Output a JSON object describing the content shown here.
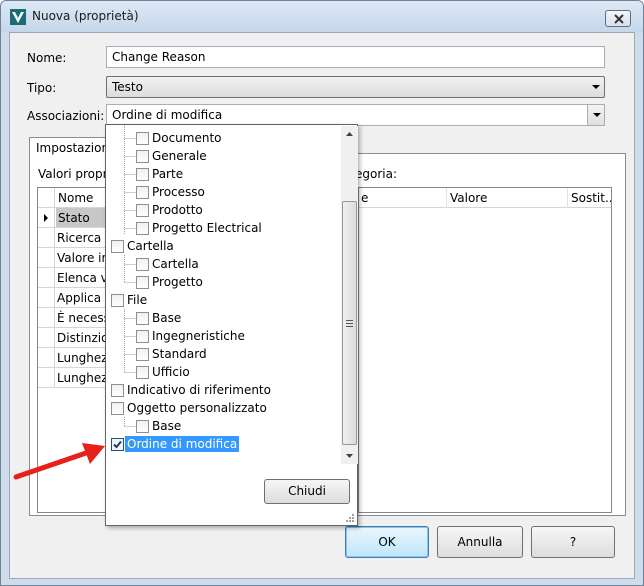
{
  "window": {
    "title": "Nuova (proprietà)"
  },
  "form": {
    "name_label": "Nome:",
    "name_value": "Change  Reason",
    "type_label": "Tipo:",
    "type_value": "Testo",
    "assoc_label": "Associazioni:",
    "assoc_value": "Ordine di modifica"
  },
  "tab": {
    "label": "Impostazioni"
  },
  "left_panel": {
    "label": "Valori propri",
    "header": "Nome",
    "rows": [
      "Stato",
      "Ricerca d",
      "Valore ini",
      "Elenca va",
      "Applica e",
      "È necessa",
      "Distinzio",
      "Lunghezz",
      "Lunghezz"
    ]
  },
  "right_panel": {
    "label": "egoria:",
    "headers": [
      "e",
      "Valore",
      "Sostit..."
    ]
  },
  "buttons": {
    "ok": "OK",
    "cancel": "Annulla",
    "help": "?"
  },
  "dropdown": {
    "close_label": "Chiudi",
    "items": [
      {
        "label": "Documento",
        "checked": false
      },
      {
        "label": "Generale",
        "checked": false
      },
      {
        "label": "Parte",
        "checked": false
      },
      {
        "label": "Processo",
        "checked": false
      },
      {
        "label": "Prodotto",
        "checked": false
      },
      {
        "label": "Progetto Electrical",
        "checked": false
      },
      {
        "label": "Cartella",
        "checked": false
      },
      {
        "label": "Cartella",
        "checked": false
      },
      {
        "label": "Progetto",
        "checked": false
      },
      {
        "label": "File",
        "checked": false
      },
      {
        "label": "Base",
        "checked": false
      },
      {
        "label": "Ingegneristiche",
        "checked": false
      },
      {
        "label": "Standard",
        "checked": false
      },
      {
        "label": "Ufficio",
        "checked": false
      },
      {
        "label": "Indicativo di riferimento",
        "checked": false
      },
      {
        "label": "Oggetto personalizzato",
        "checked": false
      },
      {
        "label": "Base",
        "checked": false
      },
      {
        "label": "Ordine di modifica",
        "checked": true,
        "selected": true
      }
    ]
  },
  "colors": {
    "selection": "#3399ff",
    "annotation_arrow": "#e8201a",
    "title_bar": "#cfdcec"
  }
}
